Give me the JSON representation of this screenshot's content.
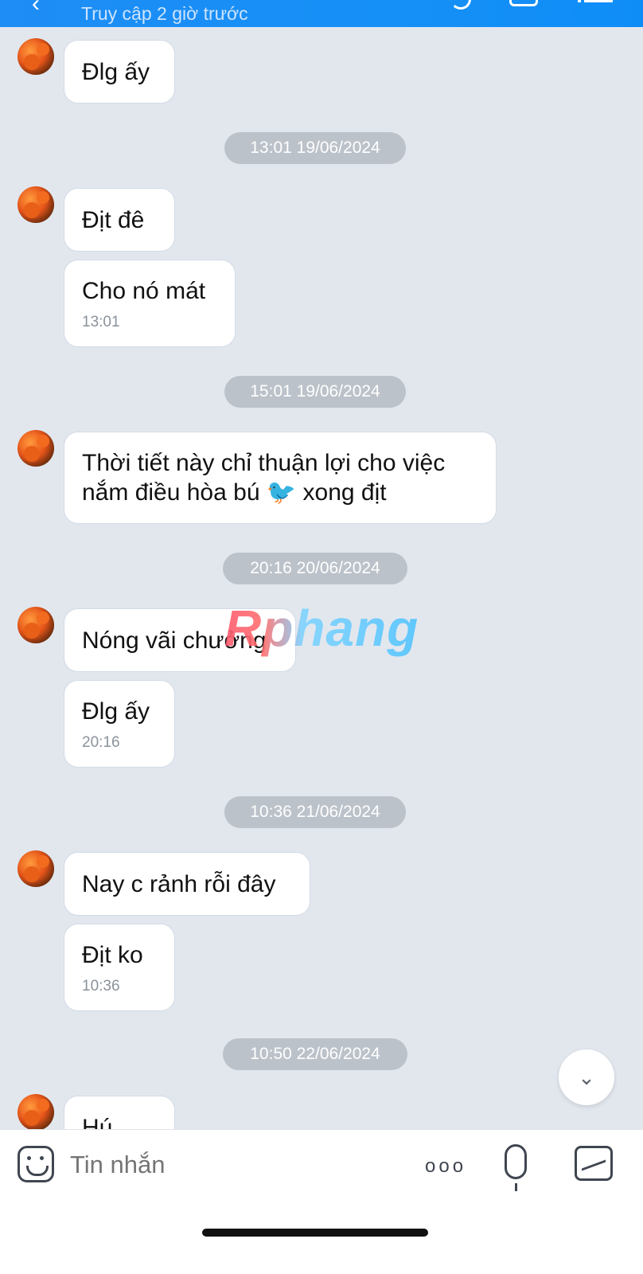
{
  "header": {
    "subtitle": "Truy cập 2 giờ trước",
    "back_icon": "chevron-left-icon",
    "call_icon": "phone-icon",
    "video_icon": "video-call-icon",
    "menu_icon": "list-menu-icon"
  },
  "messages": {
    "m1": {
      "text": "Đlg ấy"
    },
    "s1": "13:01 19/06/2024",
    "m2": {
      "text": "Địt đê"
    },
    "m3": {
      "text": "Cho nó mát",
      "time": "13:01"
    },
    "s2": "15:01 19/06/2024",
    "m4": {
      "text_line1": "Thời tiết này chỉ thuận lợi cho việc",
      "text_line2": "nắm điều hòa bú 🐦 xong địt"
    },
    "s3": "20:16 20/06/2024",
    "m5": {
      "text": "Nóng vãi chưởng"
    },
    "m6": {
      "text": "Đlg ấy",
      "time": "20:16"
    },
    "s4": "10:36 21/06/2024",
    "m7": {
      "text": "Nay c rảnh rỗi đây"
    },
    "m8": {
      "text": "Địt ko",
      "time": "10:36"
    },
    "s5": "10:50 22/06/2024",
    "m9": {
      "text": "Hú"
    }
  },
  "watermark": "Rphang",
  "scroll_button_icon": "double-chevron-down-icon",
  "composer": {
    "placeholder": "Tin nhắn",
    "emoji_icon": "sticker-icon",
    "more_icon": "more-dots-icon",
    "mic_icon": "microphone-icon",
    "gallery_icon": "image-icon",
    "dots": "ooo"
  },
  "colors": {
    "header_blue": "#1590f6",
    "background": "#e2e7ee",
    "bubble": "#ffffff",
    "timestamp_pill": "#bcc2ca"
  }
}
